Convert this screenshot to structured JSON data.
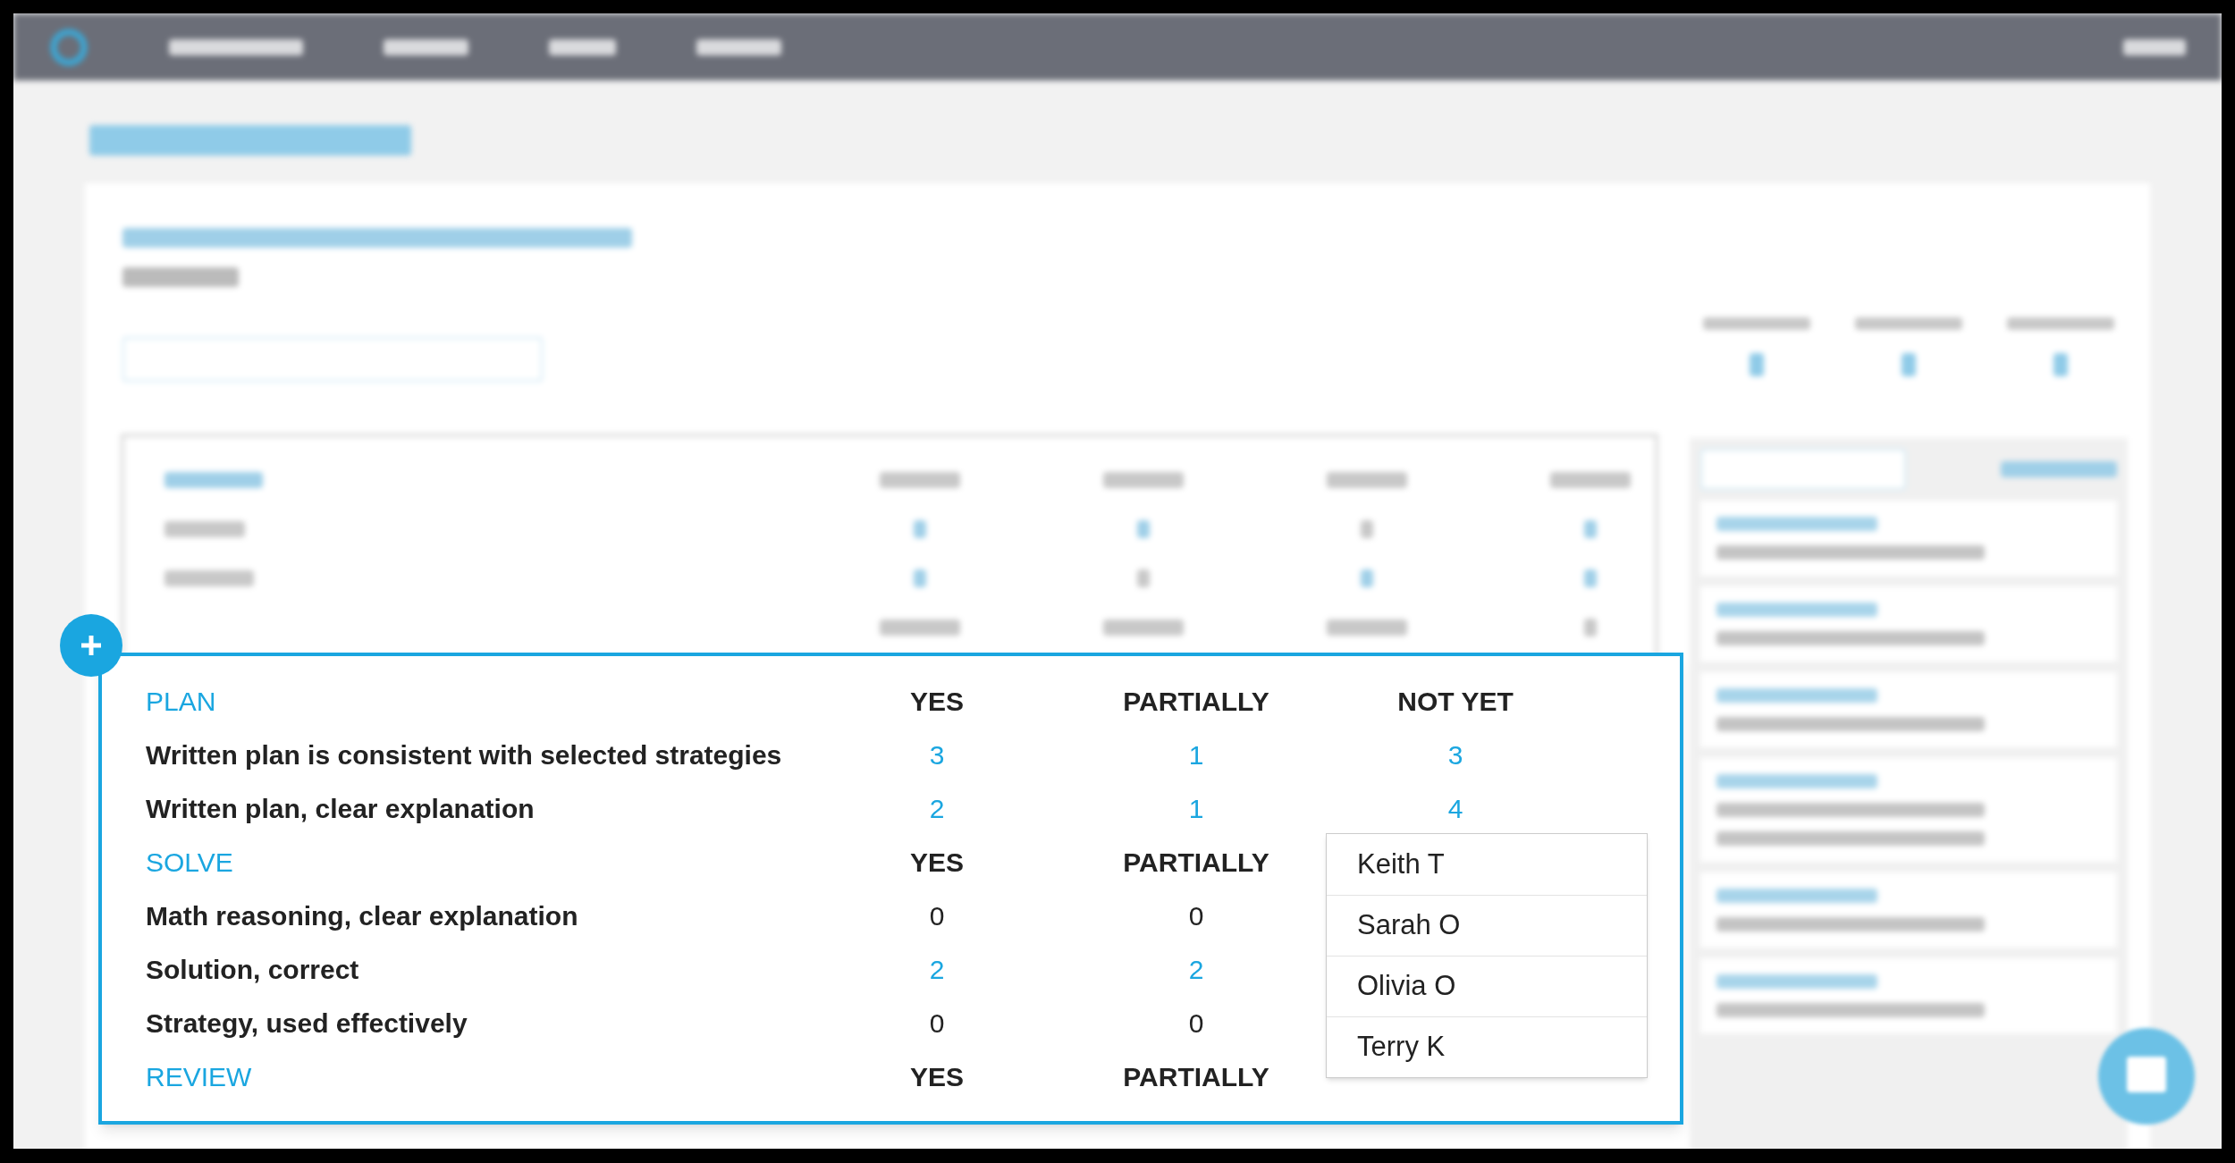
{
  "rubric": [
    {
      "heading": "PLAN",
      "columns": [
        "YES",
        "PARTIALLY",
        "NOT YET"
      ],
      "rows": [
        {
          "label": "Written plan is consistent with selected strategies",
          "values": [
            {
              "text": "3",
              "linked": true
            },
            {
              "text": "1",
              "linked": true
            },
            {
              "text": "3",
              "linked": true
            }
          ]
        },
        {
          "label": "Written plan, clear explanation",
          "values": [
            {
              "text": "2",
              "linked": true
            },
            {
              "text": "1",
              "linked": true
            },
            {
              "text": "4",
              "linked": true
            }
          ]
        }
      ]
    },
    {
      "heading": "SOLVE",
      "columns": [
        "YES",
        "PARTIALLY"
      ],
      "rows": [
        {
          "label": "Math reasoning, clear explanation",
          "values": [
            {
              "text": "0",
              "linked": false
            },
            {
              "text": "0",
              "linked": false
            }
          ]
        },
        {
          "label": "Solution, correct",
          "values": [
            {
              "text": "2",
              "linked": true
            },
            {
              "text": "2",
              "linked": true
            }
          ]
        },
        {
          "label": "Strategy, used effectively",
          "values": [
            {
              "text": "0",
              "linked": false
            },
            {
              "text": "0",
              "linked": false
            }
          ]
        }
      ]
    },
    {
      "heading": "REVIEW",
      "columns": [
        "YES",
        "PARTIALLY"
      ]
    }
  ],
  "student_popup": {
    "items": [
      "Keith T",
      "Sarah O",
      "Olivia O",
      "Terry K"
    ]
  }
}
